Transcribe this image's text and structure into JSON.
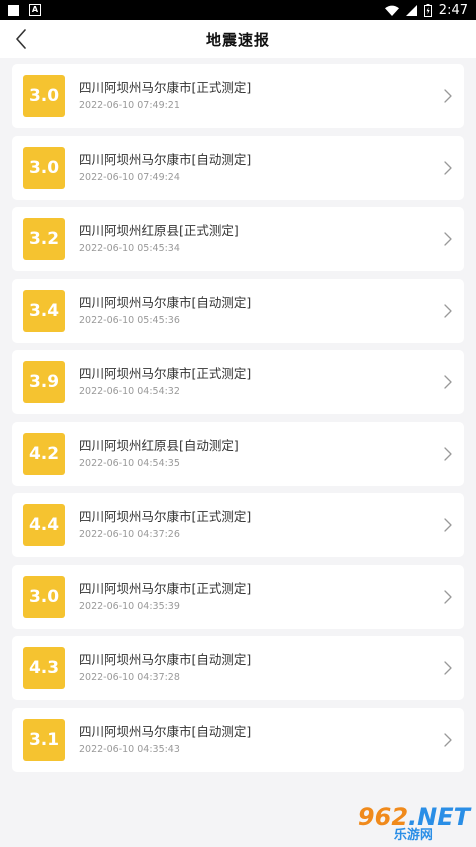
{
  "status": {
    "time": "2:47",
    "icons": [
      "square-icon",
      "a-notification-icon",
      "wifi-icon",
      "signal-icon",
      "battery-icon"
    ]
  },
  "header": {
    "title": "地震速报",
    "back_icon": "back-arrow-icon"
  },
  "colors": {
    "badge": "#f5c330",
    "background": "#f4f4f6"
  },
  "quakes": [
    {
      "mag": "3.0",
      "place": "四川阿坝州马尔康市[正式测定]",
      "time": "2022-06-10 07:49:21"
    },
    {
      "mag": "3.0",
      "place": "四川阿坝州马尔康市[自动测定]",
      "time": "2022-06-10 07:49:24"
    },
    {
      "mag": "3.2",
      "place": "四川阿坝州红原县[正式测定]",
      "time": "2022-06-10 05:45:34"
    },
    {
      "mag": "3.4",
      "place": "四川阿坝州马尔康市[自动测定]",
      "time": "2022-06-10 05:45:36"
    },
    {
      "mag": "3.9",
      "place": "四川阿坝州马尔康市[正式测定]",
      "time": "2022-06-10 04:54:32"
    },
    {
      "mag": "4.2",
      "place": "四川阿坝州红原县[自动测定]",
      "time": "2022-06-10 04:54:35"
    },
    {
      "mag": "4.4",
      "place": "四川阿坝州马尔康市[正式测定]",
      "time": "2022-06-10 04:37:26"
    },
    {
      "mag": "3.0",
      "place": "四川阿坝州马尔康市[正式测定]",
      "time": "2022-06-10 04:35:39"
    },
    {
      "mag": "4.3",
      "place": "四川阿坝州马尔康市[自动测定]",
      "time": "2022-06-10 04:37:28"
    },
    {
      "mag": "3.1",
      "place": "四川阿坝州马尔康市[自动测定]",
      "time": "2022-06-10 04:35:43"
    }
  ],
  "watermark": {
    "top_main": "962",
    "top_tail": ".NET",
    "bottom": "乐游网"
  }
}
